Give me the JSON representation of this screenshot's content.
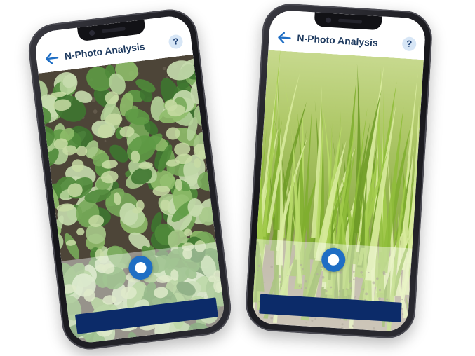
{
  "screens": [
    {
      "id": "rapeseed",
      "header": {
        "title": "N-Photo Analysis",
        "help_label": "?"
      },
      "photo": {
        "subject": "oilseed rape leaves",
        "colors": {
          "ground": "#4d4538",
          "leaf": "#6fa052",
          "leaf_light": "#c8dca4"
        }
      },
      "capture": {
        "action_label": ""
      }
    },
    {
      "id": "wheat",
      "header": {
        "title": "N-Photo Analysis",
        "help_label": "?"
      },
      "photo": {
        "subject": "young cereal shoots",
        "colors": {
          "ground": "#a89c86",
          "leaf": "#8bbd3a",
          "leaf_light": "#d9ec9e"
        }
      },
      "capture": {
        "action_label": ""
      }
    }
  ],
  "colors": {
    "accent": "#1f6ec4",
    "title": "#1e3a5f",
    "action_button": "#0c2b69",
    "help_bg": "#d7e6f6"
  },
  "icons": {
    "back": "arrow-left-icon",
    "help": "question-mark-icon",
    "shutter": "camera-shutter-icon"
  }
}
